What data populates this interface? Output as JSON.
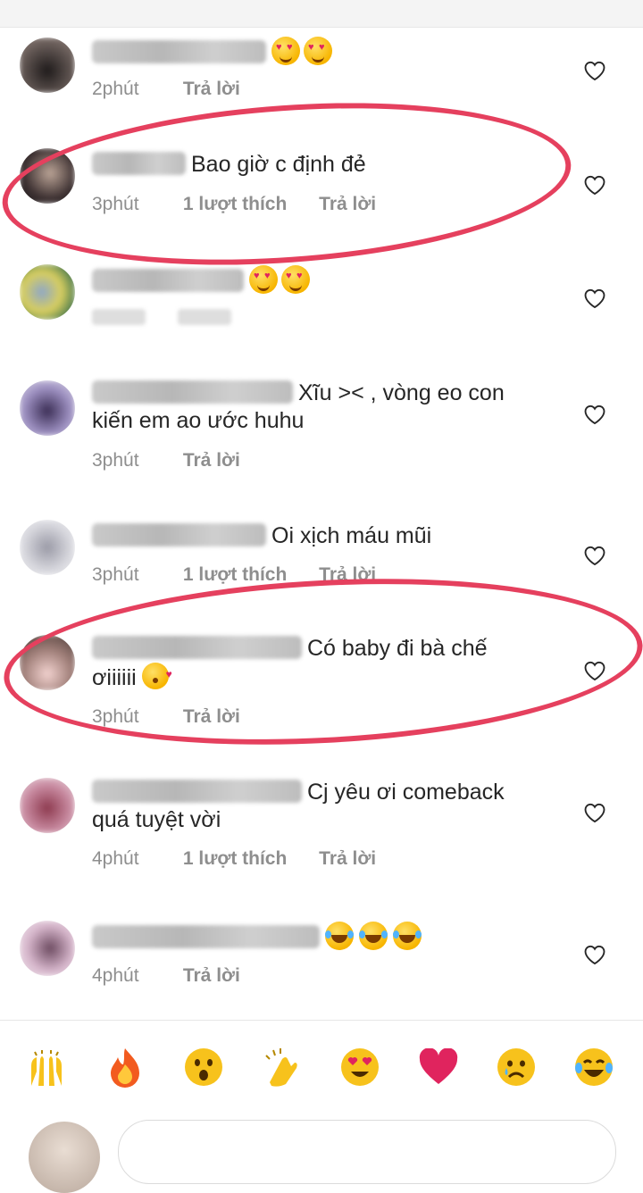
{
  "comments": [
    {
      "time": "2phút",
      "likes": "",
      "reply": "Trả lời",
      "text": "",
      "emoji": "heart-eyes-x2"
    },
    {
      "time": "3phút",
      "likes": "1 lượt thích",
      "reply": "Trả lời",
      "text": "Bao giờ c định đẻ",
      "emoji": ""
    },
    {
      "time": "",
      "likes": "",
      "reply": "",
      "text": "",
      "emoji": "heart-eyes-x2"
    },
    {
      "time": "3phút",
      "likes": "",
      "reply": "Trả lời",
      "text_line1": "Xĩu >< , vòng eo con",
      "text_line2": "kiến em ao ước huhu"
    },
    {
      "time": "3phút",
      "likes": "1 lượt thích",
      "reply": "Trả lời",
      "text": "Oi xịch máu mũi"
    },
    {
      "time": "3phút",
      "likes": "",
      "reply": "Trả lời",
      "text_line1": "Có baby đi bà chế",
      "text_line2": "ơiiiiii",
      "emoji": "kissing-face"
    },
    {
      "time": "4phút",
      "likes": "1 lượt thích",
      "reply": "Trả lời",
      "text_line1": "Cj yêu ơi comeback",
      "text_line2": "quá tuyệt vời"
    },
    {
      "time": "4phút",
      "likes": "",
      "reply": "Trả lời",
      "text": "",
      "emoji": "tears-of-joy-x3"
    }
  ],
  "emoji_bar": [
    "raising-hands",
    "fire",
    "surprised-face",
    "clapping-hands",
    "heart-eyes",
    "red-heart",
    "crying-face",
    "tears-of-joy"
  ],
  "colors": {
    "annotation_ring": "#e5405e",
    "meta_text": "#8e8e8e",
    "body_text": "#262626"
  }
}
